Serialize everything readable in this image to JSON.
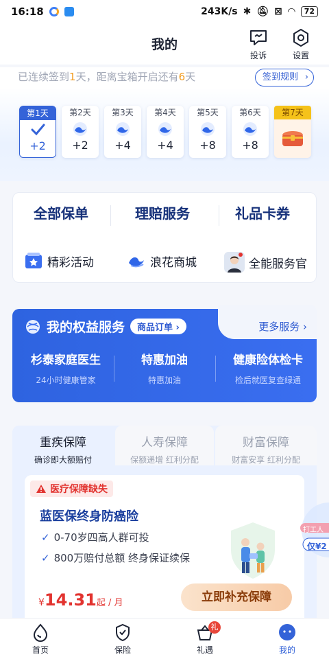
{
  "status_bar": {
    "time": "16:18",
    "speed": "243K/s",
    "battery": "72"
  },
  "header": {
    "title": "我的",
    "complaint_label": "投诉",
    "settings_label": "设置"
  },
  "checkin": {
    "text_prefix": "已连续签到",
    "streak_days": "1",
    "text_mid": "天，距离宝箱开启还有",
    "days_left": "6",
    "text_suffix": "天",
    "rule_label": "签到规则"
  },
  "days": [
    {
      "label": "第1天",
      "points": "+2"
    },
    {
      "label": "第2天",
      "points": "+2"
    },
    {
      "label": "第3天",
      "points": "+4"
    },
    {
      "label": "第4天",
      "points": "+4"
    },
    {
      "label": "第5天",
      "points": "+8"
    },
    {
      "label": "第6天",
      "points": "+8"
    },
    {
      "label": "第7天",
      "points": ""
    }
  ],
  "main_tabs": [
    "全部保单",
    "理赔服务",
    "礼品卡券"
  ],
  "quick_links": [
    "精彩活动",
    "浪花商城",
    "全能服务官"
  ],
  "benefits": {
    "title": "我的权益服务",
    "order_pill": "商品订单",
    "more_label": "更多服务",
    "services": [
      {
        "name": "杉泰家庭医生",
        "desc": "24小时健康管家"
      },
      {
        "name": "特惠加油",
        "desc": "特惠加油"
      },
      {
        "name": "健康险体检卡",
        "desc": "检后就医复查绿通"
      }
    ]
  },
  "insurance_tabs": [
    {
      "name": "重疾保障",
      "desc": "确诊即大额赔付"
    },
    {
      "name": "人寿保障",
      "desc": "保额递增 红利分配"
    },
    {
      "name": "财富保障",
      "desc": "财富安享 红利分配"
    }
  ],
  "product": {
    "gap_tag": "医疗保障缺失",
    "name": "蓝医保终身防癌险",
    "features": [
      "0-70岁四高人群可投",
      "800万赔付总额 终身保证续保"
    ],
    "price_currency": "¥",
    "price_amount": "14.31",
    "price_unit": "起 / 月",
    "cta_label": "立即补充保障"
  },
  "floating_ad": {
    "line1": "打工人",
    "line2": "仅¥2"
  },
  "bottom_nav": {
    "items": [
      "首页",
      "保险",
      "礼遇",
      "我的"
    ],
    "gift_badge": "礼"
  },
  "colors": {
    "brand_blue": "#3463d8",
    "highlight_orange": "#f29b1d",
    "alert_red": "#e2332f"
  }
}
